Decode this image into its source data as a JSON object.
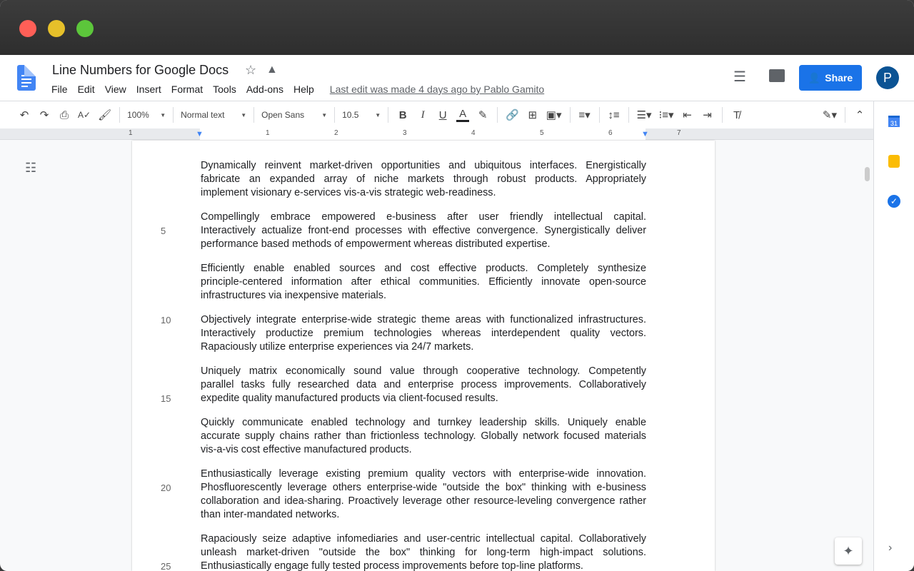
{
  "window": {
    "colors": {
      "close": "#ff5f57",
      "minimize": "#e6c02a",
      "maximize": "#5cc63b"
    }
  },
  "header": {
    "title": "Line Numbers for Google Docs",
    "menu": [
      "File",
      "Edit",
      "View",
      "Insert",
      "Format",
      "Tools",
      "Add-ons",
      "Help"
    ],
    "last_edit": "Last edit was made 4 days ago by Pablo Gamito",
    "share_label": "Share",
    "avatar_letter": "P",
    "accent": "#1a73e8"
  },
  "toolbar": {
    "zoom": "100%",
    "style": "Normal text",
    "font": "Open Sans",
    "size": "10.5",
    "bold": "B",
    "italic": "I",
    "underline": "U",
    "text_color": "A"
  },
  "ruler": {
    "labels": [
      "1",
      "1",
      "2",
      "3",
      "4",
      "5",
      "6",
      "7"
    ]
  },
  "sidebar": {
    "calendar_day": "31"
  },
  "document": {
    "paragraphs": [
      {
        "lines": [
          "Dynamically reinvent market-driven opportunities and ubiquitous interfaces. Energistically",
          "fabricate an expanded array of niche markets through robust products. Appropriately",
          "implement visionary e-services vis-a-vis strategic web-readiness."
        ],
        "numbers": [
          "",
          "",
          ""
        ]
      },
      {
        "lines": [
          "Compellingly embrace empowered e-business after user friendly intellectual capital.",
          "Interactively actualize front-end processes with effective convergence. Synergistically deliver",
          "performance based methods of empowerment whereas distributed expertise."
        ],
        "numbers": [
          "",
          "5",
          ""
        ]
      },
      {
        "lines": [
          "Efficiently enable enabled sources and cost effective products. Completely synthesize",
          "principle-centered information after ethical communities. Efficiently innovate open-source",
          "infrastructures via inexpensive materials."
        ],
        "numbers": [
          "",
          "",
          ""
        ]
      },
      {
        "lines": [
          "Objectively integrate enterprise-wide strategic theme areas with functionalized infrastructures.",
          "Interactively productize premium technologies whereas interdependent quality vectors.",
          "Rapaciously utilize enterprise experiences via 24/7 markets."
        ],
        "numbers": [
          "10",
          "",
          ""
        ]
      },
      {
        "lines": [
          "Uniquely matrix economically sound value through cooperative technology. Competently",
          "parallel tasks fully researched data and enterprise process improvements. Collaboratively",
          "expedite quality manufactured products via client-focused results."
        ],
        "numbers": [
          "",
          "",
          "15"
        ]
      },
      {
        "lines": [
          "Quickly communicate enabled technology and turnkey leadership skills. Uniquely enable",
          "accurate supply chains rather than frictionless technology. Globally network focused materials",
          "vis-a-vis cost effective manufactured products."
        ],
        "numbers": [
          "",
          "",
          ""
        ]
      },
      {
        "lines": [
          "Enthusiastically leverage existing premium quality vectors with enterprise-wide innovation.",
          "Phosfluorescently leverage others enterprise-wide \"outside the box\" thinking with e-business",
          "collaboration and idea-sharing. Proactively leverage other resource-leveling convergence rather",
          "than inter-mandated networks."
        ],
        "numbers": [
          "",
          "20",
          "",
          ""
        ]
      },
      {
        "lines": [
          "Rapaciously seize adaptive infomediaries and user-centric intellectual capital. Collaboratively",
          "unleash market-driven \"outside the box\" thinking for long-term high-impact solutions.",
          "Enthusiastically engage fully tested process improvements before top-line platforms."
        ],
        "numbers": [
          "",
          "",
          "25"
        ]
      }
    ]
  }
}
